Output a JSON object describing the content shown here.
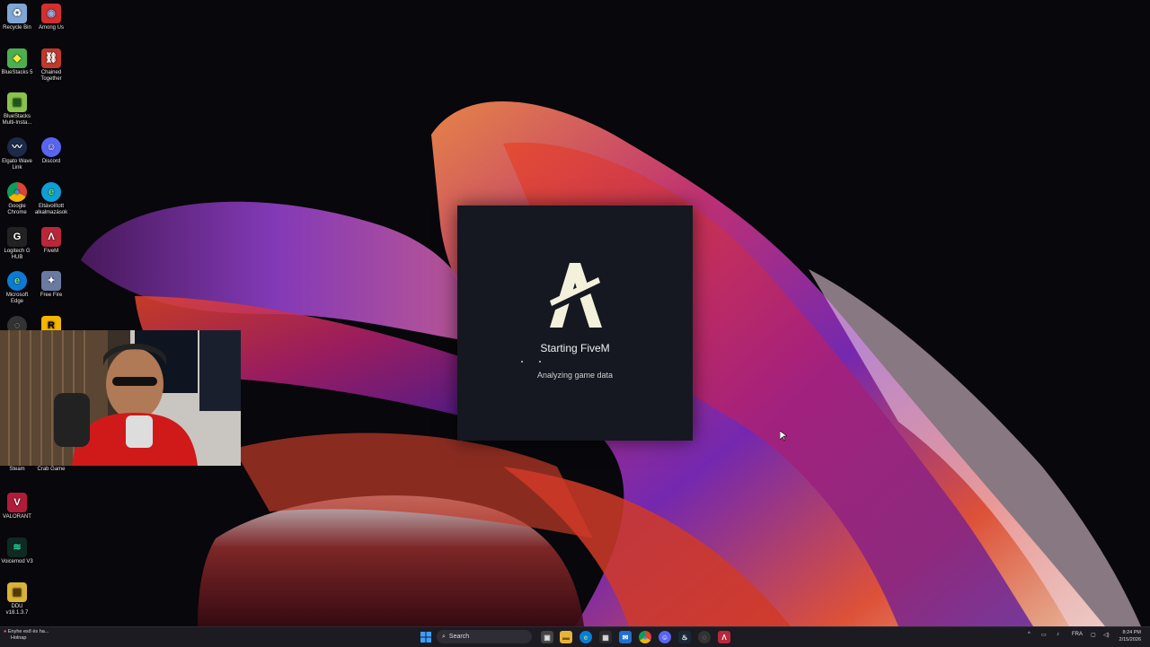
{
  "desktop": {
    "icons": [
      {
        "label": "Recycle Bin",
        "icon": "recycle-bin-icon",
        "color": "#7fa7d6",
        "glyph": "♻"
      },
      {
        "label": "Among Us",
        "icon": "among-us-icon",
        "color": "#d32f2f",
        "glyph": "◉"
      },
      {
        "label": "BlueStacks 5",
        "icon": "bluestacks-icon",
        "color": "#4caf50",
        "glyph": "◆"
      },
      {
        "label": "Chained Together",
        "icon": "chained-together-icon",
        "color": "#c0392b",
        "glyph": "⛓"
      },
      {
        "label": "BlueStacks Multi-Insta...",
        "icon": "bluestacks-multi-icon",
        "color": "#8bc34a",
        "glyph": "▦"
      },
      {
        "label": "Elgato Wave Link",
        "icon": "wave-link-icon",
        "color": "#1e2a4a",
        "glyph": "〰"
      },
      {
        "label": "Discord",
        "icon": "discord-icon",
        "color": "#5865f2",
        "glyph": "☺"
      },
      {
        "label": "Google Chrome",
        "icon": "chrome-icon",
        "color": "#db4437",
        "glyph": "◎"
      },
      {
        "label": "Eltávolított alkalmazások",
        "icon": "edge-icon",
        "color": "#0f9ed5",
        "glyph": "e"
      },
      {
        "label": "Logitech G HUB",
        "icon": "logitech-icon",
        "color": "#222222",
        "glyph": "G"
      },
      {
        "label": "FiveM",
        "icon": "fivem-icon",
        "color": "#b8283a",
        "glyph": "Λ"
      },
      {
        "label": "Microsoft Edge",
        "icon": "microsoft-edge-icon",
        "color": "#0c7bd4",
        "glyph": "e"
      },
      {
        "label": "Free Fire",
        "icon": "free-fire-icon",
        "color": "#6b7aa1",
        "glyph": "✦"
      },
      {
        "label": "Steam",
        "icon": "steam-icon",
        "color": "#1b2838",
        "glyph": "♨"
      },
      {
        "label": "Crab Game",
        "icon": "crab-game-icon",
        "color": "#ffffff",
        "glyph": "▬"
      },
      {
        "label": "VALORANT",
        "icon": "valorant-icon",
        "color": "#b01c3a",
        "glyph": "V"
      },
      {
        "label": "Voicemod V3",
        "icon": "voicemod-icon",
        "color": "#0f2a22",
        "glyph": "≋"
      },
      {
        "label": "DDU v18.1.3.7",
        "icon": "ddu-icon",
        "color": "#d9b23a",
        "glyph": "▤"
      }
    ]
  },
  "splash": {
    "title": "Starting FiveM",
    "status": "Analyzing game data"
  },
  "taskbar": {
    "weather_line1": "Enyhe eső és ha...",
    "weather_line2": "Holnap",
    "search_placeholder": "Search",
    "language": "FRA",
    "time": "8:24 PM",
    "date": "2/15/2026"
  }
}
